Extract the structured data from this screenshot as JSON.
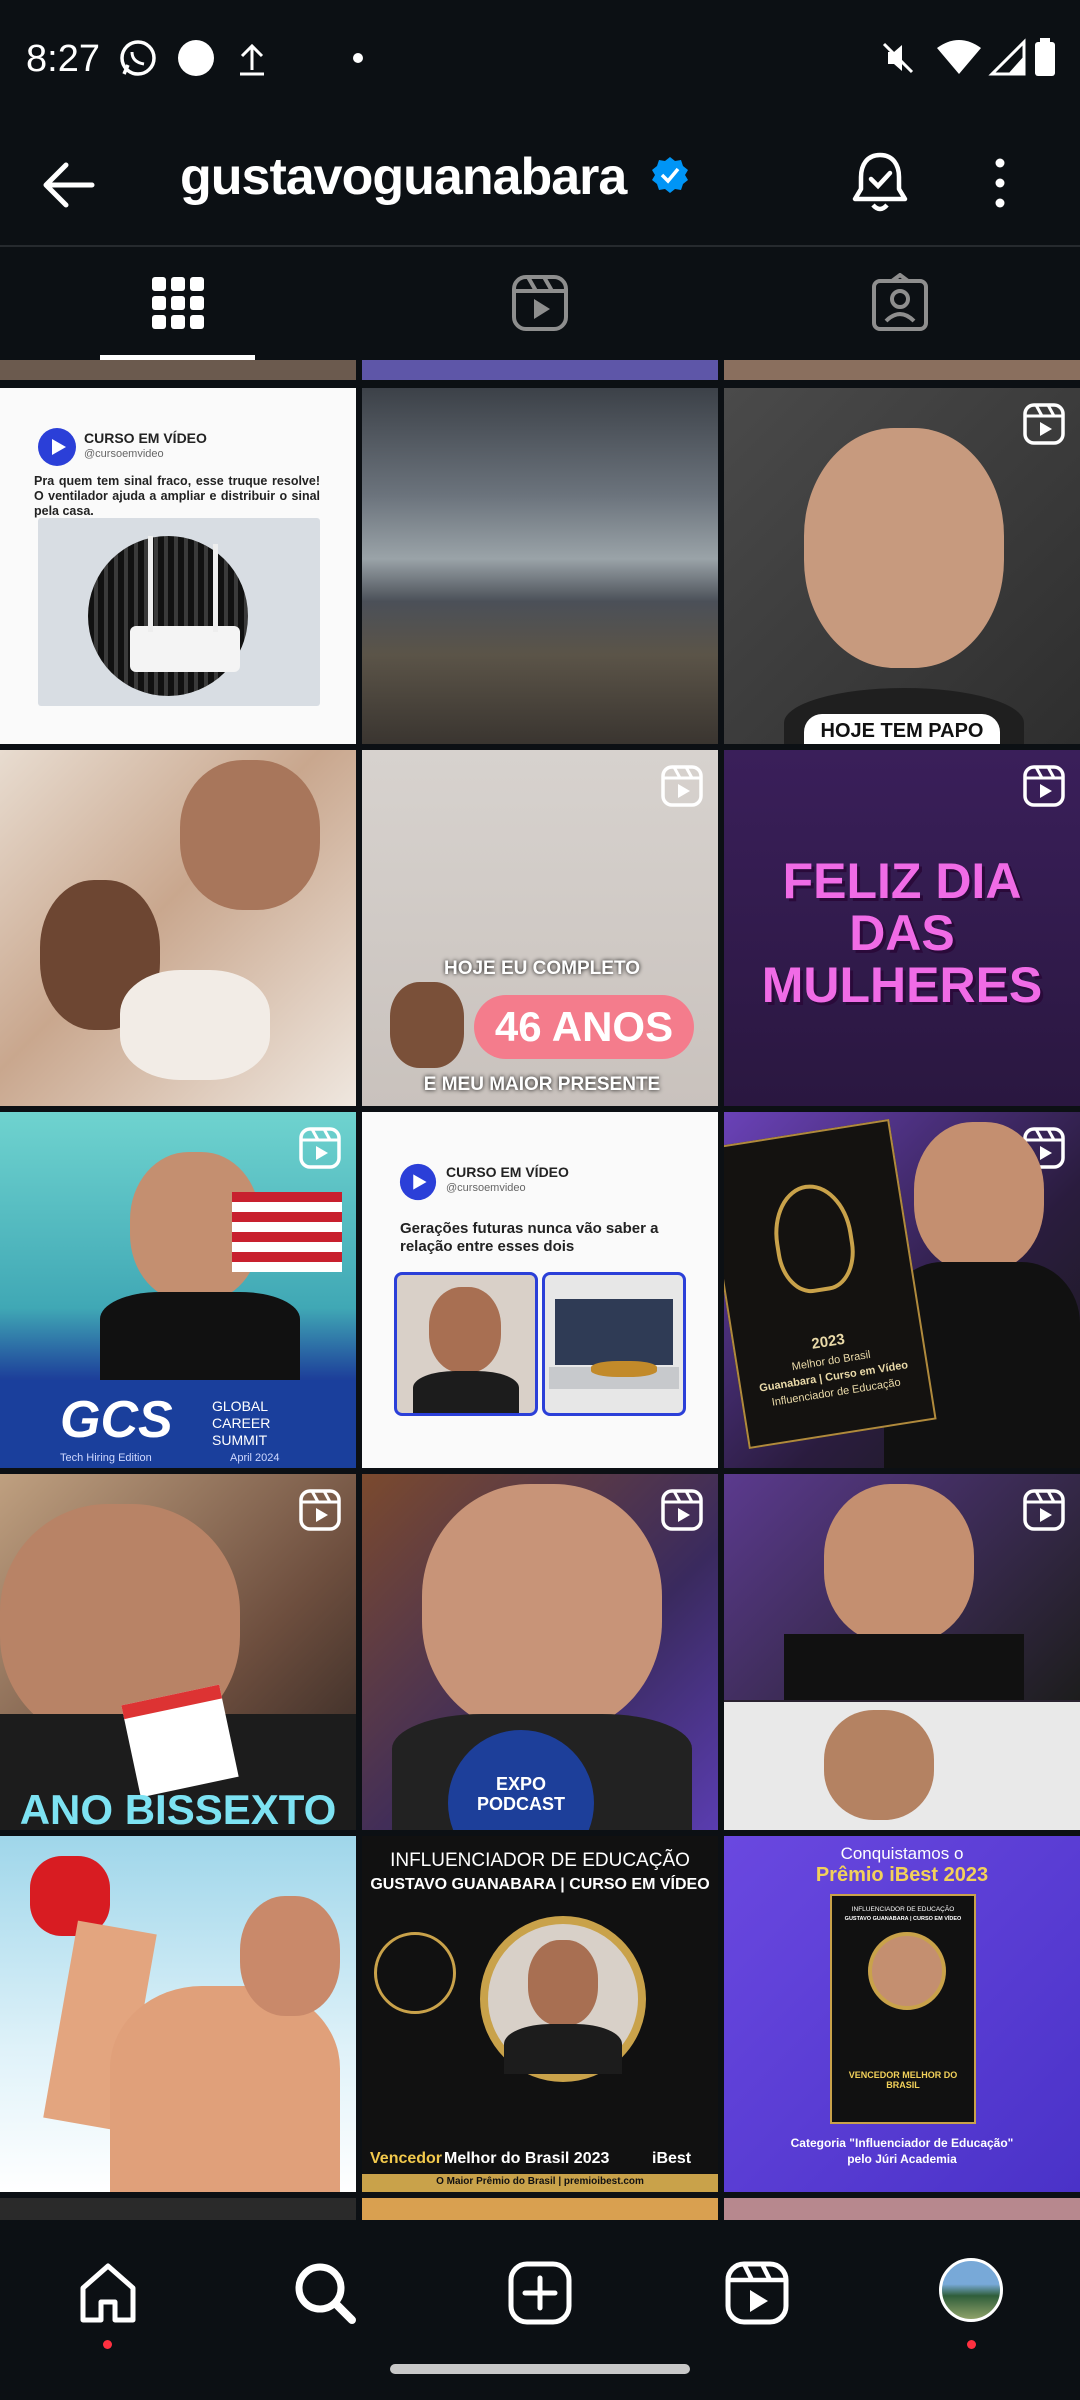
{
  "status_bar": {
    "time": "8:27"
  },
  "header": {
    "username": "gustavoguanabara"
  },
  "tiles": {
    "t1": {
      "brand": "CURSO EM VÍDEO",
      "handle": "@cursoemvideo",
      "text": "Pra quem tem sinal fraco, esse truque resolve! O ventilador ajuda a ampliar e distribuir o sinal pela casa."
    },
    "t3": {
      "caption": "HOJE TEM PAPO"
    },
    "t5": {
      "line1": "HOJE EU COMPLETO",
      "badge": "46 ANOS",
      "line2": "E MEU MAIOR PRESENTE"
    },
    "t6": {
      "text": "FELIZ DIA DAS MULHERES"
    },
    "t7": {
      "logo": "GCS",
      "line1": "GLOBAL",
      "line2": "CAREER",
      "line3": "SUMMIT",
      "bottom": "Tech Hiring Edition",
      "date": "April 2024"
    },
    "t8": {
      "brand": "CURSO EM VÍDEO",
      "handle": "@cursoemvideo",
      "text": "Gerações futuras nunca vão saber a relação entre esses dois"
    },
    "t9": {
      "l1": "Melhor do Brasil",
      "l2": "Guanabara | Curso em Vídeo",
      "l3": "Influenciador de Educação",
      "year": "2023"
    },
    "t10": {
      "caption": "ANO BISSEXTO"
    },
    "t11": {
      "caption": "EXPO PODCAST"
    },
    "t14": {
      "line1": "INFLUENCIADOR DE EDUCAÇÃO",
      "line2": "GUSTAVO GUANABARA | CURSO EM VÍDEO",
      "bottom_a": "Vencedor",
      "bottom_b": "Melhor do Brasil 2023",
      "bottom_c": "iBest",
      "footer": "O Maior Prêmio do Brasil | premioibest.com"
    },
    "t15": {
      "line1": "Conquistamos o",
      "line2": "Prêmio iBest 2023",
      "poster_top": "INFLUENCIADOR DE EDUCAÇÃO",
      "poster_name": "GUSTAVO GUANABARA | CURSO EM VÍDEO",
      "poster_bottom": "VENCEDOR MELHOR DO BRASIL",
      "foot1": "Categoria \"Influenciador de Educação\"",
      "foot2": "pelo Júri Academia"
    }
  },
  "icons": {
    "back": "arrow-left-icon",
    "verified": "verified-badge-icon",
    "bell": "bell-icon",
    "more": "more-vertical-icon",
    "grid": "grid-icon",
    "reels": "reels-icon",
    "tagged": "tagged-icon",
    "home": "home-icon",
    "search": "search-icon",
    "create": "create-icon",
    "profile": "profile-avatar"
  },
  "colors": {
    "background": "#0c1014",
    "verified": "#0095f6",
    "notification_dot": "#ff3040"
  }
}
